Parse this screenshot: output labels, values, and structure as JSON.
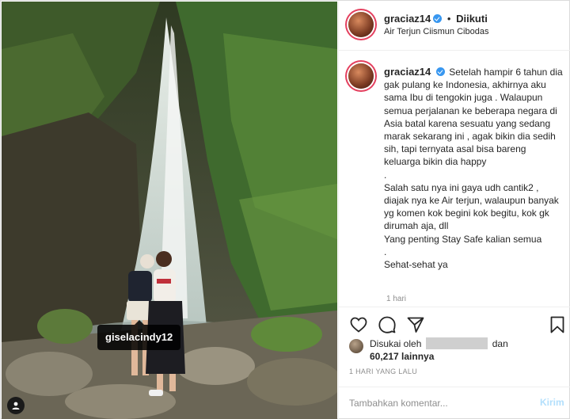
{
  "post": {
    "tagged_user": "giselacindy12"
  },
  "header": {
    "username": "graciaz14",
    "dot": "•",
    "follow_status": "Diikuti",
    "location": "Air Terjun Ciismun Cibodas"
  },
  "caption": {
    "username": "graciaz14",
    "paragraphs": [
      "Setelah hampir 6 tahun dia gak pulang ke Indonesia, akhirnya aku sama Ibu di tengokin juga . Walaupun semua perjalanan ke beberapa negara di Asia batal karena sesuatu yang sedang marak sekarang ini , agak bikin dia sedih sih, tapi ternyata asal bisa bareng keluarga bikin dia happy",
      ".",
      "Salah satu nya ini gaya udh cantik2 , diajak nya ke Air terjun, walaupun banyak yg komen kok begini kok begitu, kok gk dirumah aja, dll",
      "Yang penting Stay Safe kalian semua",
      ".",
      "Sehat-sehat ya"
    ],
    "time": "1 hari"
  },
  "likes": {
    "prefix": "Disukai oleh",
    "and": "dan",
    "count": "60,217 lainnya"
  },
  "posted_ago": "1 HARI YANG LALU",
  "comment": {
    "placeholder": "Tambahkan komentar...",
    "post_label": "Kirim"
  },
  "icons": {
    "like": "heart-icon",
    "comment": "comment-icon",
    "share": "paper-plane-icon",
    "save": "bookmark-icon",
    "user_tag": "person-icon",
    "verified": "verified-badge-icon"
  },
  "colors": {
    "verified": "#3897f0",
    "story_ring": "#e4405f",
    "post_button_disabled": "#b2dffc",
    "muted_text": "#8e8e8e"
  }
}
